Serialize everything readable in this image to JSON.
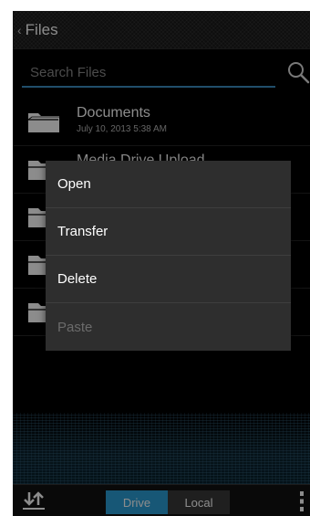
{
  "header": {
    "back_glyph": "‹",
    "title": "Files"
  },
  "search": {
    "placeholder": "Search Files",
    "icon": "search-icon"
  },
  "files": [
    {
      "name": "Documents",
      "date": "July 10, 2013 5:38 AM"
    },
    {
      "name": "Media Drive Upload",
      "date": ""
    },
    {
      "name": "",
      "date": ""
    },
    {
      "name": "",
      "date": ""
    },
    {
      "name": "",
      "date": ""
    }
  ],
  "context_menu": {
    "items": [
      {
        "label": "Open",
        "enabled": true
      },
      {
        "label": "Transfer",
        "enabled": true
      },
      {
        "label": "Delete",
        "enabled": true
      },
      {
        "label": "Paste",
        "enabled": false
      }
    ]
  },
  "bottom_bar": {
    "segment": {
      "drive": "Drive",
      "local": "Local",
      "selected": "Drive"
    }
  },
  "colors": {
    "accent": "#2a9fd8",
    "search_underline": "#3b8fc4",
    "menu_bg": "#2e2e2e"
  }
}
